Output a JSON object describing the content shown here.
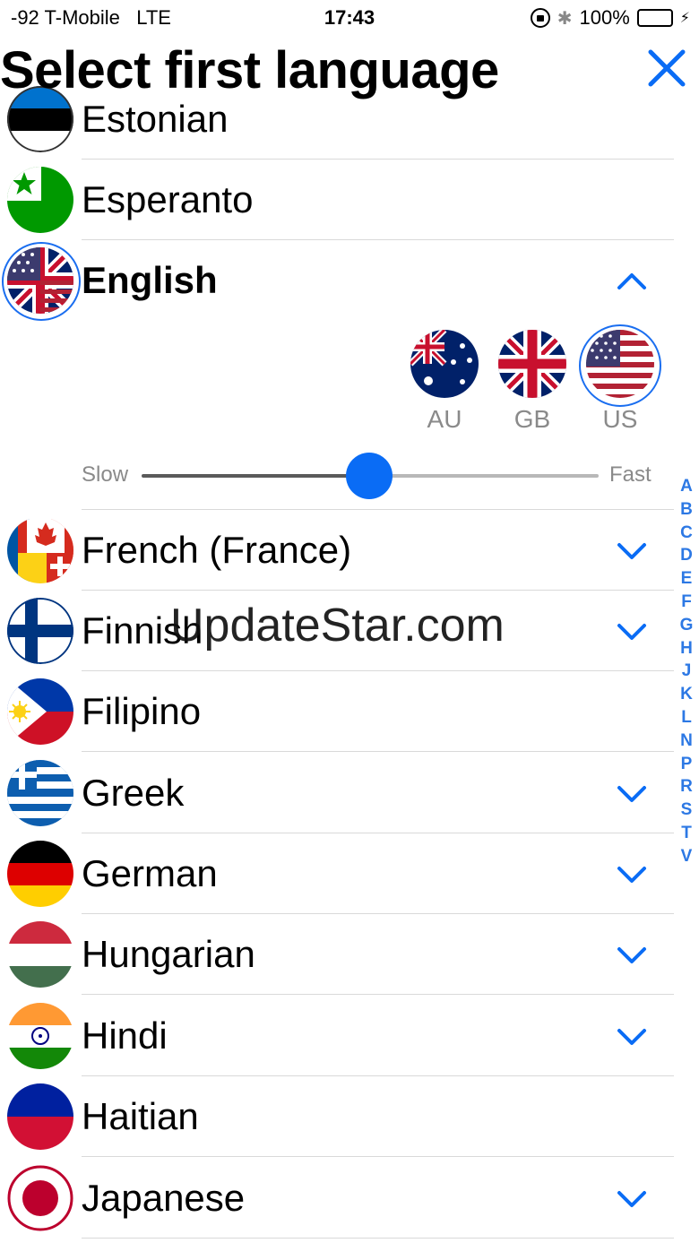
{
  "status_bar": {
    "carrier": "-92 T-Mobile",
    "network": "LTE",
    "time": "17:43",
    "battery": "100%"
  },
  "header": {
    "title": "Select first language",
    "close_icon": "close-icon"
  },
  "languages": [
    {
      "name": "Estonian",
      "flag": "estonian-flag-icon",
      "expandable": false
    },
    {
      "name": "Esperanto",
      "flag": "esperanto-flag-icon",
      "expandable": false
    },
    {
      "name": "English",
      "flag": "english-flag-icon",
      "expandable": true,
      "expanded": true,
      "selected": true
    },
    {
      "name": "French (France)",
      "flag": "french-flag-icon",
      "expandable": true
    },
    {
      "name": "Finnish",
      "flag": "finnish-flag-icon",
      "expandable": true
    },
    {
      "name": "Filipino",
      "flag": "filipino-flag-icon",
      "expandable": false
    },
    {
      "name": "Greek",
      "flag": "greek-flag-icon",
      "expandable": true
    },
    {
      "name": "German",
      "flag": "german-flag-icon",
      "expandable": true
    },
    {
      "name": "Hungarian",
      "flag": "hungarian-flag-icon",
      "expandable": true
    },
    {
      "name": "Hindi",
      "flag": "hindi-flag-icon",
      "expandable": true
    },
    {
      "name": "Haitian",
      "flag": "haitian-flag-icon",
      "expandable": false
    },
    {
      "name": "Japanese",
      "flag": "japanese-flag-icon",
      "expandable": true
    }
  ],
  "english_variants": [
    {
      "code": "AU",
      "selected": false
    },
    {
      "code": "GB",
      "selected": false
    },
    {
      "code": "US",
      "selected": true
    }
  ],
  "speed": {
    "slow_label": "Slow",
    "fast_label": "Fast",
    "value": 0.5
  },
  "alpha_index": [
    "A",
    "B",
    "C",
    "D",
    "E",
    "F",
    "G",
    "H",
    "J",
    "K",
    "L",
    "N",
    "P",
    "R",
    "S",
    "T",
    "V"
  ],
  "watermark": "UpdateStar.com",
  "colors": {
    "accent": "#0a6cf5",
    "index": "#2c78e4",
    "separator": "#d9d9d9",
    "secondary_text": "#8a8a8a"
  }
}
